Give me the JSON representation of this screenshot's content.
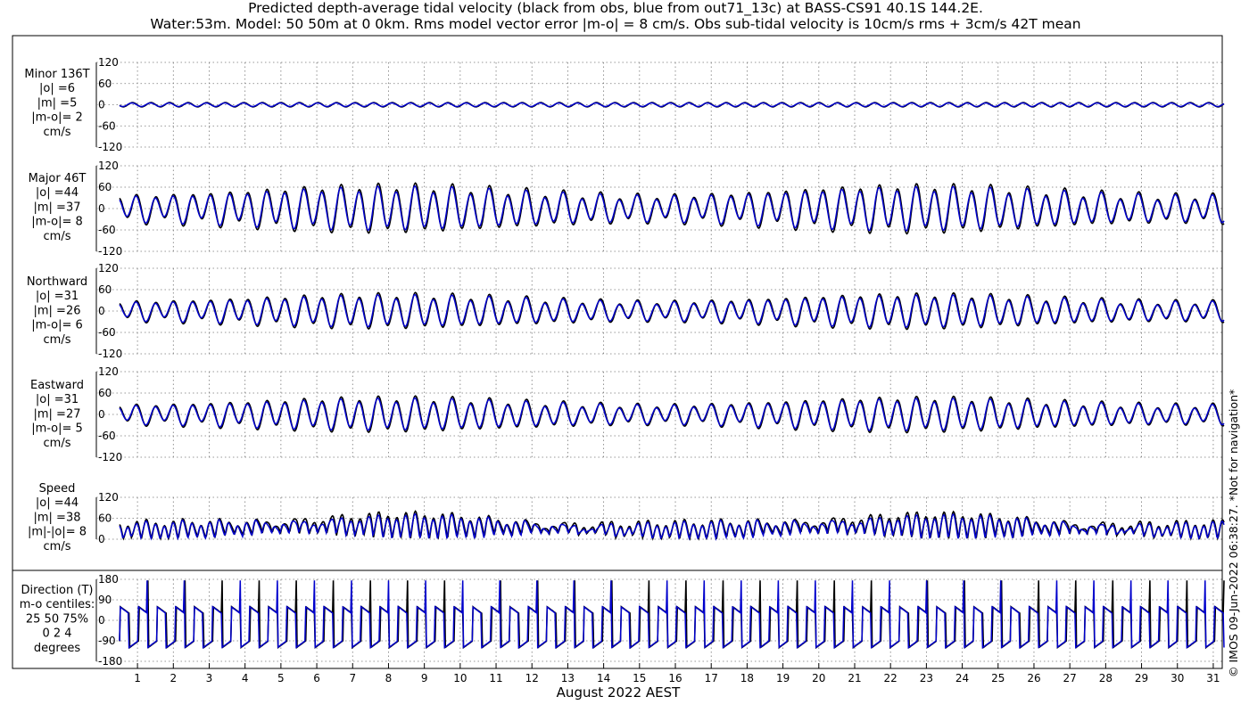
{
  "title": {
    "line1": "Predicted depth-average tidal velocity (black from obs, blue from out71_13c) at BASS-CS91 40.1S 144.2E.",
    "line2": "Water:53m. Model: 50 50m at 0 0km. Rms model vector error |m-o| = 8 cm/s. Obs sub-tidal velocity is 10cm/s rms + 3cm/s 42T mean"
  },
  "xlabel": "August 2022 AEST",
  "copyright": "© IMOS 09-Jun-2022 06:38:27. *Not for navigation*",
  "colors": {
    "obs": "#000000",
    "model": "#0000cc",
    "grid": "#777777"
  },
  "chart_data": {
    "type": "line",
    "x_range": [
      0.5,
      31.3
    ],
    "x_ticks": [
      1,
      2,
      3,
      4,
      5,
      6,
      7,
      8,
      9,
      10,
      11,
      12,
      13,
      14,
      15,
      16,
      17,
      18,
      19,
      20,
      21,
      22,
      23,
      24,
      25,
      26,
      27,
      28,
      29,
      30,
      31
    ],
    "grid": true,
    "series_names": [
      "obs",
      "model"
    ],
    "panels": [
      {
        "id": "minor",
        "label_lines": [
          "Minor 136T",
          "|o| =6",
          "|m| =5",
          "|m-o|= 2",
          "cm/s"
        ],
        "ylim": [
          -120,
          120
        ],
        "yticks": [
          "120",
          "60",
          "0",
          "-60",
          "-120"
        ],
        "ytick_values": [
          120,
          60,
          0,
          -60,
          -120
        ],
        "series": {
          "obs_amp": 6,
          "model_amp": 5,
          "offset": 0
        }
      },
      {
        "id": "major",
        "label_lines": [
          "Major 46T",
          "|o| =44",
          "|m| =37",
          "|m-o|= 8",
          "cm/s"
        ],
        "ylim": [
          -120,
          120
        ],
        "yticks": [
          "120",
          "60",
          "0",
          "-60",
          "-120"
        ],
        "ytick_values": [
          120,
          60,
          0,
          -60,
          -120
        ],
        "series": {
          "obs_amp": 62,
          "model_amp": 55,
          "offset": 0
        }
      },
      {
        "id": "northward",
        "label_lines": [
          "Northward",
          "|o| =31",
          "|m| =26",
          "|m-o|= 6",
          "cm/s"
        ],
        "ylim": [
          -120,
          120
        ],
        "yticks": [
          "120",
          "60",
          "0",
          "-60",
          "-120"
        ],
        "ytick_values": [
          120,
          60,
          0,
          -60,
          -120
        ],
        "series": {
          "obs_amp": 45,
          "model_amp": 40,
          "offset": 0
        }
      },
      {
        "id": "eastward",
        "label_lines": [
          "Eastward",
          "|o| =31",
          "|m| =27",
          "|m-o|= 5",
          "cm/s"
        ],
        "ylim": [
          -120,
          120
        ],
        "yticks": [
          "120",
          "60",
          "0",
          "-60",
          "-120"
        ],
        "ytick_values": [
          120,
          60,
          0,
          -60,
          -120
        ],
        "series": {
          "obs_amp": 45,
          "model_amp": 40,
          "offset": 0
        }
      },
      {
        "id": "speed",
        "label_lines": [
          "Speed",
          "|o| =44",
          "|m| =38",
          "|m|-|o|= 8",
          "cm/s"
        ],
        "ylim": [
          0,
          120
        ],
        "yticks": [
          "120",
          "60",
          "0"
        ],
        "ytick_values": [
          120,
          60,
          0
        ],
        "series": {
          "obs_amp": 62,
          "model_amp": 55,
          "offset": 0
        }
      },
      {
        "id": "direction",
        "label_lines": [
          "Direction (T)",
          "m-o centiles:",
          "25  50  75%",
          "0   2   4",
          "degrees"
        ],
        "ylim": [
          -180,
          180
        ],
        "yticks": [
          "180",
          "90",
          "0",
          "-90",
          "-180"
        ],
        "ytick_values": [
          180,
          90,
          0,
          -90,
          -180
        ],
        "series": {
          "obs_amp": 180,
          "model_amp": 180,
          "offset": 0
        }
      }
    ]
  }
}
